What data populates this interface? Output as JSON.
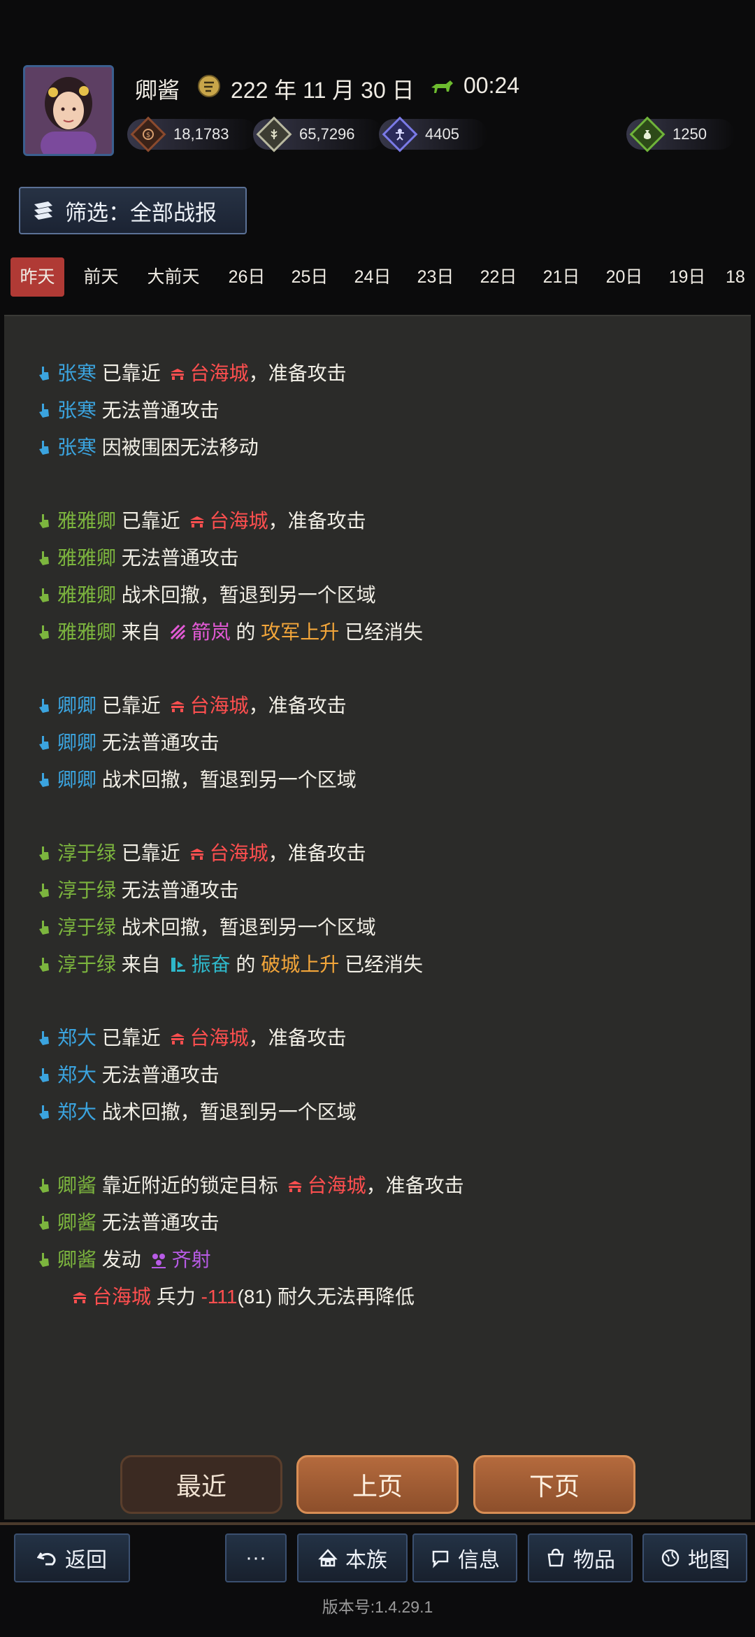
{
  "header": {
    "player_name": "卿酱",
    "date": "222 年 11 月 30 日",
    "time": "00:24",
    "resources": [
      {
        "icon": "coin-icon",
        "value": "18,1783",
        "color": "#a0522d"
      },
      {
        "icon": "grain-icon",
        "value": "65,7296",
        "color": "#c8c8b0"
      },
      {
        "icon": "troops-icon",
        "value": "4405",
        "color": "#6a6ad8"
      },
      {
        "icon": "jade-bag-icon",
        "value": "1250",
        "color": "#5a9e2a"
      }
    ]
  },
  "filter": {
    "label": "筛选：全部战报"
  },
  "date_tabs": [
    "昨天",
    "前天",
    "大前天",
    "26日",
    "25日",
    "24日",
    "23日",
    "22日",
    "21日",
    "20日",
    "19日",
    "18"
  ],
  "log": {
    "g1": {
      "l1": {
        "name": "张寒",
        "a": "已靠近",
        "city": "台海城",
        "b": "，准备攻击"
      },
      "l2": {
        "name": "张寒",
        "a": "无法普通攻击"
      },
      "l3": {
        "name": "张寒",
        "a": "因被围困无法移动"
      }
    },
    "g2": {
      "l1": {
        "name": "雅雅卿",
        "a": "已靠近",
        "city": "台海城",
        "b": "，准备攻击"
      },
      "l2": {
        "name": "雅雅卿",
        "a": "无法普通攻击"
      },
      "l3": {
        "name": "雅雅卿",
        "a": "战术回撤，暂退到另一个区域"
      },
      "l4": {
        "name": "雅雅卿",
        "a": "来自",
        "skill": "箭岚",
        "mid": "的",
        "effect": "攻军上升",
        "end": "已经消失"
      }
    },
    "g3": {
      "l1": {
        "name": "卿卿",
        "a": "已靠近",
        "city": "台海城",
        "b": "，准备攻击"
      },
      "l2": {
        "name": "卿卿",
        "a": "无法普通攻击"
      },
      "l3": {
        "name": "卿卿",
        "a": "战术回撤，暂退到另一个区域"
      }
    },
    "g4": {
      "l1": {
        "name": "淳于绿",
        "a": "已靠近",
        "city": "台海城",
        "b": "，准备攻击"
      },
      "l2": {
        "name": "淳于绿",
        "a": "无法普通攻击"
      },
      "l3": {
        "name": "淳于绿",
        "a": "战术回撤，暂退到另一个区域"
      },
      "l4": {
        "name": "淳于绿",
        "a": "来自",
        "skill": "振奋",
        "mid": "的",
        "effect": "破城上升",
        "end": "已经消失"
      }
    },
    "g5": {
      "l1": {
        "name": "郑大",
        "a": "已靠近",
        "city": "台海城",
        "b": "，准备攻击"
      },
      "l2": {
        "name": "郑大",
        "a": "无法普通攻击"
      },
      "l3": {
        "name": "郑大",
        "a": "战术回撤，暂退到另一个区域"
      }
    },
    "g6": {
      "l1": {
        "name": "卿酱",
        "a": "靠近附近的锁定目标",
        "city": "台海城",
        "b": "，准备攻击"
      },
      "l2": {
        "name": "卿酱",
        "a": "无法普通攻击"
      },
      "l3": {
        "name": "卿酱",
        "a": "发动",
        "skill": "齐射"
      },
      "l4": {
        "city": "台海城",
        "a": "兵力",
        "delta": "-111",
        "b": "(81) 耐久无法再降低"
      }
    }
  },
  "pagination": {
    "recent": "最近",
    "prev": "上页",
    "next": "下页"
  },
  "nav": {
    "back": "返回",
    "more": "···",
    "clan": "本族",
    "info": "信息",
    "items": "物品",
    "map": "地图"
  },
  "version": "版本号:1.4.29.1"
}
